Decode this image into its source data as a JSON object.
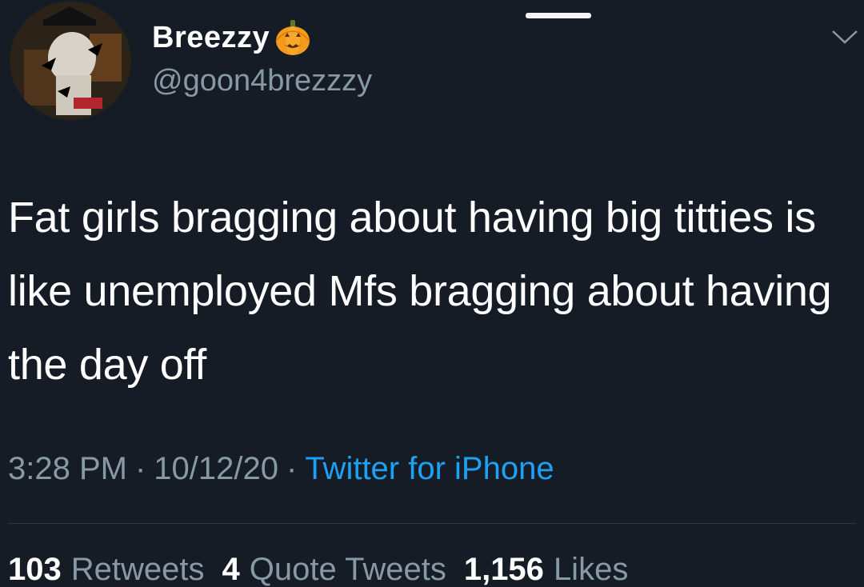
{
  "user": {
    "display_name": "Breezzy",
    "handle": "@goon4brezzzy",
    "badge_icon": "pumpkin-icon"
  },
  "tweet": {
    "text": "Fat girls bragging about having big titties is like unemployed Mfs bragging about having the day off",
    "time": "3:28 PM",
    "date": "10/12/20",
    "separator": "·",
    "source": "Twitter for iPhone"
  },
  "stats": {
    "retweets_count": "103",
    "retweets_label": "Retweets",
    "quotes_count": "4",
    "quotes_label": "Quote Tweets",
    "likes_count": "1,156",
    "likes_label": "Likes"
  },
  "colors": {
    "background": "#151c26",
    "text": "#ffffff",
    "muted": "#8899a6",
    "link": "#1da1f2"
  }
}
